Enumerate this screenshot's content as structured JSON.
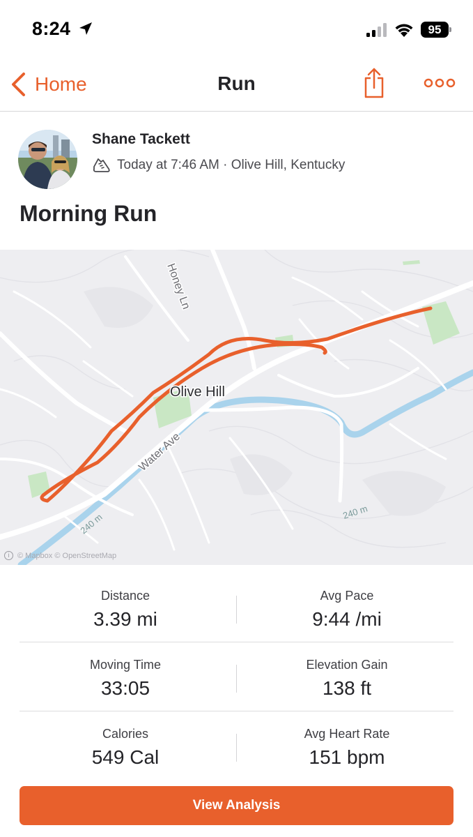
{
  "status_bar": {
    "time": "8:24",
    "battery": "95",
    "icons": [
      "location-arrow-icon",
      "cellular-signal-icon",
      "wifi-icon",
      "battery-icon"
    ]
  },
  "nav": {
    "back_label": "Home",
    "title": "Run",
    "icons": [
      "chevron-left-icon",
      "share-icon",
      "more-icon"
    ]
  },
  "athlete": {
    "name": "Shane Tackett",
    "meta": "Today at 7:46 AM · Olive Hill, Kentucky",
    "activity_icon": "running-shoe-icon"
  },
  "activity": {
    "title": "Morning Run"
  },
  "map": {
    "place_label": "Olive Hill",
    "street_labels": [
      "Honey Ln",
      "Water Ave"
    ],
    "contour_labels": [
      "240 m",
      "240 m"
    ],
    "attribution": "© Mapbox © OpenStreetMap",
    "route_color": "#E8602C",
    "water_color": "#A9D3EC",
    "park_color": "#C9E7C4"
  },
  "stats": [
    {
      "label": "Distance",
      "value": "3.39 mi"
    },
    {
      "label": "Avg Pace",
      "value": "9:44 /mi"
    },
    {
      "label": "Moving Time",
      "value": "33:05"
    },
    {
      "label": "Elevation Gain",
      "value": "138 ft"
    },
    {
      "label": "Calories",
      "value": "549 Cal"
    },
    {
      "label": "Avg Heart Rate",
      "value": "151 bpm"
    }
  ],
  "actions": {
    "view_analysis": "View Analysis"
  },
  "colors": {
    "accent": "#E8602C",
    "text_primary": "#242428"
  }
}
